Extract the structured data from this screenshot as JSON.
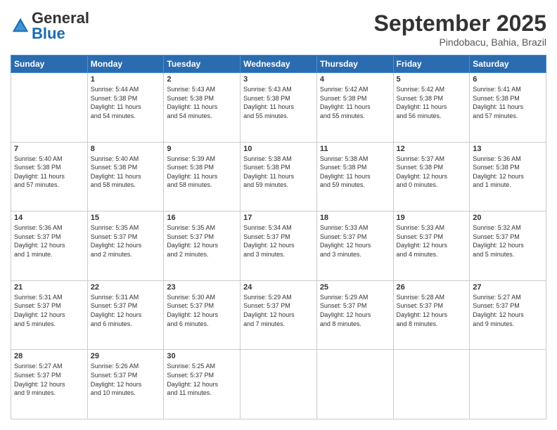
{
  "header": {
    "logo_general": "General",
    "logo_blue": "Blue",
    "month_title": "September 2025",
    "location": "Pindobacu, Bahia, Brazil"
  },
  "days_of_week": [
    "Sunday",
    "Monday",
    "Tuesday",
    "Wednesday",
    "Thursday",
    "Friday",
    "Saturday"
  ],
  "weeks": [
    [
      {
        "day": "",
        "info": ""
      },
      {
        "day": "1",
        "info": "Sunrise: 5:44 AM\nSunset: 5:38 PM\nDaylight: 11 hours\nand 54 minutes."
      },
      {
        "day": "2",
        "info": "Sunrise: 5:43 AM\nSunset: 5:38 PM\nDaylight: 11 hours\nand 54 minutes."
      },
      {
        "day": "3",
        "info": "Sunrise: 5:43 AM\nSunset: 5:38 PM\nDaylight: 11 hours\nand 55 minutes."
      },
      {
        "day": "4",
        "info": "Sunrise: 5:42 AM\nSunset: 5:38 PM\nDaylight: 11 hours\nand 55 minutes."
      },
      {
        "day": "5",
        "info": "Sunrise: 5:42 AM\nSunset: 5:38 PM\nDaylight: 11 hours\nand 56 minutes."
      },
      {
        "day": "6",
        "info": "Sunrise: 5:41 AM\nSunset: 5:38 PM\nDaylight: 11 hours\nand 57 minutes."
      }
    ],
    [
      {
        "day": "7",
        "info": "Sunrise: 5:40 AM\nSunset: 5:38 PM\nDaylight: 11 hours\nand 57 minutes."
      },
      {
        "day": "8",
        "info": "Sunrise: 5:40 AM\nSunset: 5:38 PM\nDaylight: 11 hours\nand 58 minutes."
      },
      {
        "day": "9",
        "info": "Sunrise: 5:39 AM\nSunset: 5:38 PM\nDaylight: 11 hours\nand 58 minutes."
      },
      {
        "day": "10",
        "info": "Sunrise: 5:38 AM\nSunset: 5:38 PM\nDaylight: 11 hours\nand 59 minutes."
      },
      {
        "day": "11",
        "info": "Sunrise: 5:38 AM\nSunset: 5:38 PM\nDaylight: 11 hours\nand 59 minutes."
      },
      {
        "day": "12",
        "info": "Sunrise: 5:37 AM\nSunset: 5:38 PM\nDaylight: 12 hours\nand 0 minutes."
      },
      {
        "day": "13",
        "info": "Sunrise: 5:36 AM\nSunset: 5:38 PM\nDaylight: 12 hours\nand 1 minute."
      }
    ],
    [
      {
        "day": "14",
        "info": "Sunrise: 5:36 AM\nSunset: 5:37 PM\nDaylight: 12 hours\nand 1 minute."
      },
      {
        "day": "15",
        "info": "Sunrise: 5:35 AM\nSunset: 5:37 PM\nDaylight: 12 hours\nand 2 minutes."
      },
      {
        "day": "16",
        "info": "Sunrise: 5:35 AM\nSunset: 5:37 PM\nDaylight: 12 hours\nand 2 minutes."
      },
      {
        "day": "17",
        "info": "Sunrise: 5:34 AM\nSunset: 5:37 PM\nDaylight: 12 hours\nand 3 minutes."
      },
      {
        "day": "18",
        "info": "Sunrise: 5:33 AM\nSunset: 5:37 PM\nDaylight: 12 hours\nand 3 minutes."
      },
      {
        "day": "19",
        "info": "Sunrise: 5:33 AM\nSunset: 5:37 PM\nDaylight: 12 hours\nand 4 minutes."
      },
      {
        "day": "20",
        "info": "Sunrise: 5:32 AM\nSunset: 5:37 PM\nDaylight: 12 hours\nand 5 minutes."
      }
    ],
    [
      {
        "day": "21",
        "info": "Sunrise: 5:31 AM\nSunset: 5:37 PM\nDaylight: 12 hours\nand 5 minutes."
      },
      {
        "day": "22",
        "info": "Sunrise: 5:31 AM\nSunset: 5:37 PM\nDaylight: 12 hours\nand 6 minutes."
      },
      {
        "day": "23",
        "info": "Sunrise: 5:30 AM\nSunset: 5:37 PM\nDaylight: 12 hours\nand 6 minutes."
      },
      {
        "day": "24",
        "info": "Sunrise: 5:29 AM\nSunset: 5:37 PM\nDaylight: 12 hours\nand 7 minutes."
      },
      {
        "day": "25",
        "info": "Sunrise: 5:29 AM\nSunset: 5:37 PM\nDaylight: 12 hours\nand 8 minutes."
      },
      {
        "day": "26",
        "info": "Sunrise: 5:28 AM\nSunset: 5:37 PM\nDaylight: 12 hours\nand 8 minutes."
      },
      {
        "day": "27",
        "info": "Sunrise: 5:27 AM\nSunset: 5:37 PM\nDaylight: 12 hours\nand 9 minutes."
      }
    ],
    [
      {
        "day": "28",
        "info": "Sunrise: 5:27 AM\nSunset: 5:37 PM\nDaylight: 12 hours\nand 9 minutes."
      },
      {
        "day": "29",
        "info": "Sunrise: 5:26 AM\nSunset: 5:37 PM\nDaylight: 12 hours\nand 10 minutes."
      },
      {
        "day": "30",
        "info": "Sunrise: 5:25 AM\nSunset: 5:37 PM\nDaylight: 12 hours\nand 11 minutes."
      },
      {
        "day": "",
        "info": ""
      },
      {
        "day": "",
        "info": ""
      },
      {
        "day": "",
        "info": ""
      },
      {
        "day": "",
        "info": ""
      }
    ]
  ]
}
